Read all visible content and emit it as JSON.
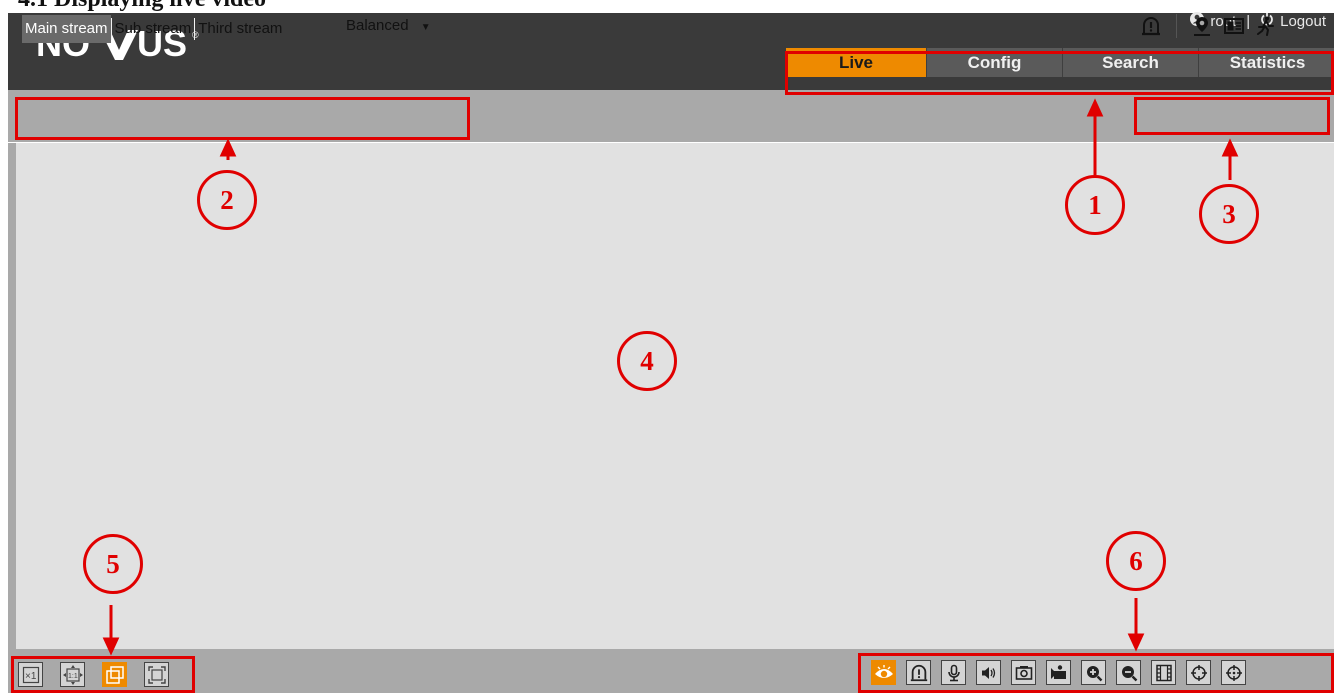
{
  "document": {
    "heading": "4.1 Displaying live video"
  },
  "header": {
    "logo_text": "NOVUS",
    "user": {
      "icon": "user-icon",
      "name": "root",
      "separator": "|",
      "logout_icon": "power-icon",
      "logout_label": "Logout"
    },
    "tabs": [
      {
        "label": "Live",
        "active": true
      },
      {
        "label": "Config",
        "active": false
      },
      {
        "label": "Search",
        "active": false
      },
      {
        "label": "Statistics",
        "active": false
      }
    ]
  },
  "toolbar": {
    "streams": [
      {
        "label": "Main stream",
        "active": true
      },
      {
        "label": "Sub stream",
        "active": false
      },
      {
        "label": "Third stream",
        "active": false
      }
    ],
    "quality": {
      "selected": "Balanced",
      "icon": "caret-down-icon"
    },
    "status_icons": [
      "alarm-icon",
      "location-icon",
      "info-panel-icon",
      "motion-person-icon"
    ]
  },
  "bottom_bar": {
    "view_controls": [
      {
        "icon": "original-size-icon",
        "active": false
      },
      {
        "icon": "fit-1to1-icon",
        "active": false
      },
      {
        "icon": "window-fit-icon",
        "active": true
      },
      {
        "icon": "fullscreen-icon",
        "active": false
      }
    ],
    "live_controls": [
      {
        "icon": "live-view-eye-icon",
        "active": true
      },
      {
        "icon": "alarm-icon",
        "active": false
      },
      {
        "icon": "microphone-icon",
        "active": false
      },
      {
        "icon": "speaker-icon",
        "active": false
      },
      {
        "icon": "snapshot-icon",
        "active": false
      },
      {
        "icon": "record-icon",
        "active": false
      },
      {
        "icon": "zoom-in-icon",
        "active": false
      },
      {
        "icon": "zoom-out-icon",
        "active": false
      },
      {
        "icon": "film-strip-icon",
        "active": false
      },
      {
        "icon": "ptz-target-icon",
        "active": false
      },
      {
        "icon": "ptz-crosshair-icon",
        "active": false
      }
    ]
  },
  "callouts": [
    "1",
    "2",
    "3",
    "4",
    "5",
    "6"
  ],
  "colors": {
    "accent": "#ee8a00",
    "header_bg": "#3a3a3a",
    "bar_bg": "#a9a9a9",
    "video_bg": "#e1e1e1",
    "annotation": "#e00000"
  }
}
